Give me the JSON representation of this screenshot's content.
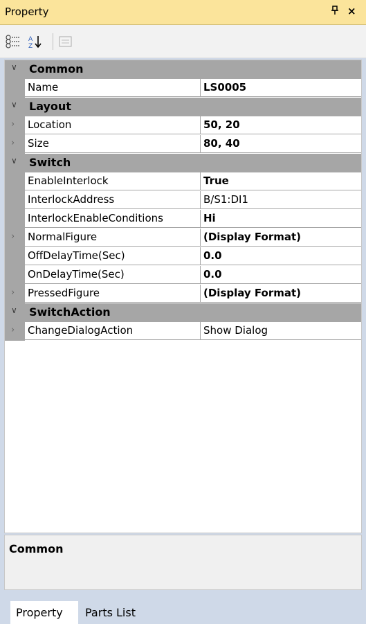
{
  "panel": {
    "title": "Property",
    "pin_glyph": "ᵖ",
    "close_glyph": "×"
  },
  "toolbar": {
    "buttons": [
      {
        "icon": "categorized-icon"
      },
      {
        "icon": "sort-alphabetical-icon"
      },
      {
        "icon": "property-pages-icon"
      }
    ]
  },
  "grid": {
    "rows": [
      {
        "type": "category",
        "label": "Common"
      },
      {
        "type": "property",
        "name": "Name",
        "value": "LS0005",
        "bold": true,
        "expandable": false
      },
      {
        "type": "category",
        "label": "Layout"
      },
      {
        "type": "property",
        "name": "Location",
        "value": "50, 20",
        "bold": true,
        "expandable": true
      },
      {
        "type": "property",
        "name": "Size",
        "value": "80, 40",
        "bold": true,
        "expandable": true
      },
      {
        "type": "category",
        "label": "Switch"
      },
      {
        "type": "property",
        "name": "EnableInterlock",
        "value": "True",
        "bold": true,
        "expandable": false
      },
      {
        "type": "property",
        "name": "InterlockAddress",
        "value": "B/S1:DI1",
        "bold": false,
        "expandable": false
      },
      {
        "type": "property",
        "name": "InterlockEnableConditions",
        "value": "Hi",
        "bold": true,
        "expandable": false
      },
      {
        "type": "property",
        "name": "NormalFigure",
        "value": "(Display Format)",
        "bold": true,
        "expandable": true
      },
      {
        "type": "property",
        "name": "OffDelayTime(Sec)",
        "value": "0.0",
        "bold": true,
        "expandable": false
      },
      {
        "type": "property",
        "name": "OnDelayTime(Sec)",
        "value": "0.0",
        "bold": true,
        "expandable": false
      },
      {
        "type": "property",
        "name": "PressedFigure",
        "value": "(Display Format)",
        "bold": true,
        "expandable": true
      },
      {
        "type": "category",
        "label": "SwitchAction"
      },
      {
        "type": "property",
        "name": "ChangeDialogAction",
        "value": "Show Dialog",
        "bold": false,
        "expandable": true
      }
    ]
  },
  "description": {
    "title": "Common"
  },
  "tabs": [
    {
      "label": "Property",
      "active": true
    },
    {
      "label": "Parts List",
      "active": false
    }
  ]
}
